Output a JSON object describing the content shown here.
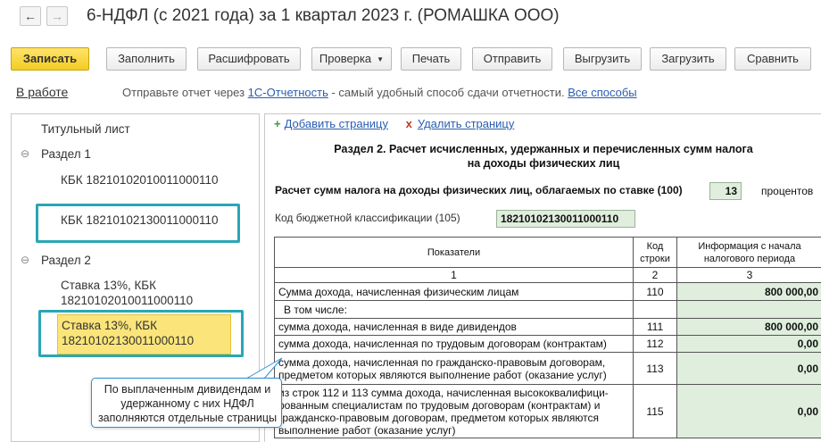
{
  "window": {
    "title": "6-НДФЛ (с 2021 года) за 1 квартал 2023 г. (РОМАШКА ООО)",
    "back_glyph": "←",
    "forward_glyph": "→"
  },
  "toolbar": {
    "save": "Записать",
    "fill": "Заполнить",
    "decode": "Расшифровать",
    "check": "Проверка",
    "print": "Печать",
    "send": "Отправить",
    "export": "Выгрузить",
    "import": "Загрузить",
    "compare": "Сравнить"
  },
  "infobar": {
    "status": "В работе",
    "text_before": "Отправьте отчет через ",
    "link1": "1С-Отчетность",
    "text_after": " - самый удобный способ сдачи отчетности. ",
    "link2": "Все способы"
  },
  "sidebar": {
    "title_page": "Титульный лист",
    "section1": "Раздел 1",
    "kbk1": "КБК 18210102010011000110",
    "kbk2": "КБК 18210102130011000110",
    "section2": "Раздел 2",
    "rate1_line1": "Ставка 13%, КБК",
    "rate1_line2": "18210102010011000110",
    "rate2_line1": "Ставка 13%, КБК",
    "rate2_line2": "18210102130011000110",
    "toggle_glyph": "⊖"
  },
  "page_actions": {
    "add": "Добавить страницу",
    "delete": "Удалить страницу"
  },
  "form": {
    "title_line1": "Раздел 2. Расчет исчисленных, удержанных и перечисленных сумм налога",
    "title_line2": "на доходы физических лиц",
    "rate_label": "Расчет сумм налога на доходы физических лиц, облагаемых по ставке   (100)",
    "rate_value": "13",
    "rate_unit": "процентов",
    "kbk_label": "Код бюджетной классификации   (105)",
    "kbk_value": "18210102130011000110",
    "headers": {
      "indicators": "Показатели",
      "code": "Код строки",
      "info": "Информация с начала налогового периода"
    },
    "col_numbers": [
      "1",
      "2",
      "3"
    ],
    "rows": [
      {
        "label": "Сумма дохода, начисленная физическим лицам",
        "code": "110",
        "value": "800 000,00"
      },
      {
        "label": "В том числе:",
        "code": "",
        "value": ""
      },
      {
        "label": "сумма дохода, начисленная в виде дивидендов",
        "code": "111",
        "value": "800 000,00"
      },
      {
        "label": "сумма дохода, начисленная по трудовым договорам (контрактам)",
        "code": "112",
        "value": "0,00"
      },
      {
        "label": "сумма дохода, начисленная по гражданско-правовым договорам, предметом которых являются выполнение работ (оказание услуг)",
        "code": "113",
        "value": "0,00"
      },
      {
        "label": "из строк 112 и 113 сумма дохода, начисленная высококвалифици-рованным специалистам по трудовым договорам (контрактам) и гражданско-правовым договорам, предметом которых являются выполнение работ (оказание услуг)",
        "code": "115",
        "value": "0,00"
      }
    ]
  },
  "callout": {
    "text": "По выплаченным дивидендам и удержанному с них НДФЛ заполняются отдельные страницы"
  }
}
